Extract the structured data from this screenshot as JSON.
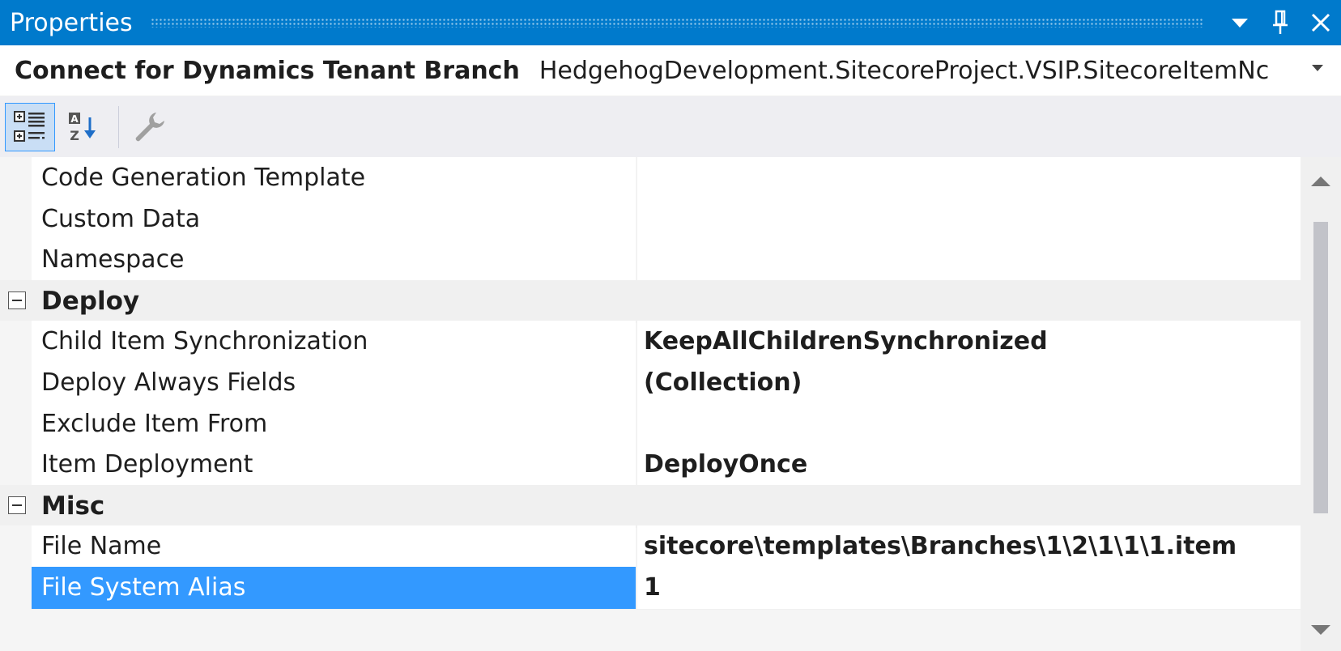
{
  "window": {
    "title": "Properties",
    "dropdown_icon": "triangle-down-icon",
    "pin_icon": "pin-icon",
    "close_icon": "close-icon"
  },
  "object_selector": {
    "name": "Connect for Dynamics Tenant Branch",
    "type": "HedgehogDevelopment.SitecoreProject.VSIP.SitecoreItemNc"
  },
  "toolbar": {
    "categorized_icon": "categorized-view-icon",
    "alphabetical_icon": "sort-alphabetical-icon",
    "property_pages_icon": "wrench-icon"
  },
  "grid": {
    "rows": [
      {
        "kind": "prop",
        "name": "Code Generation Template",
        "value": "",
        "bold": false
      },
      {
        "kind": "prop",
        "name": "Custom Data",
        "value": "",
        "bold": false
      },
      {
        "kind": "prop",
        "name": "Namespace",
        "value": "",
        "bold": false
      },
      {
        "kind": "category",
        "name": "Deploy"
      },
      {
        "kind": "prop",
        "name": "Child Item Synchronization",
        "value": "KeepAllChildrenSynchronized",
        "bold": true
      },
      {
        "kind": "prop",
        "name": "Deploy Always Fields",
        "value": "(Collection)",
        "bold": true
      },
      {
        "kind": "prop",
        "name": "Exclude Item From",
        "value": "",
        "bold": false
      },
      {
        "kind": "prop",
        "name": "Item Deployment",
        "value": "DeployOnce",
        "bold": true
      },
      {
        "kind": "category",
        "name": "Misc"
      },
      {
        "kind": "prop",
        "name": "File Name",
        "value": "sitecore\\templates\\Branches\\1\\2\\1\\1\\1.item",
        "bold": true
      },
      {
        "kind": "prop",
        "name": "File System Alias",
        "value": "1",
        "bold": true,
        "selected": true
      }
    ]
  },
  "colors": {
    "accent": "#007acc",
    "selection": "#3399ff"
  }
}
